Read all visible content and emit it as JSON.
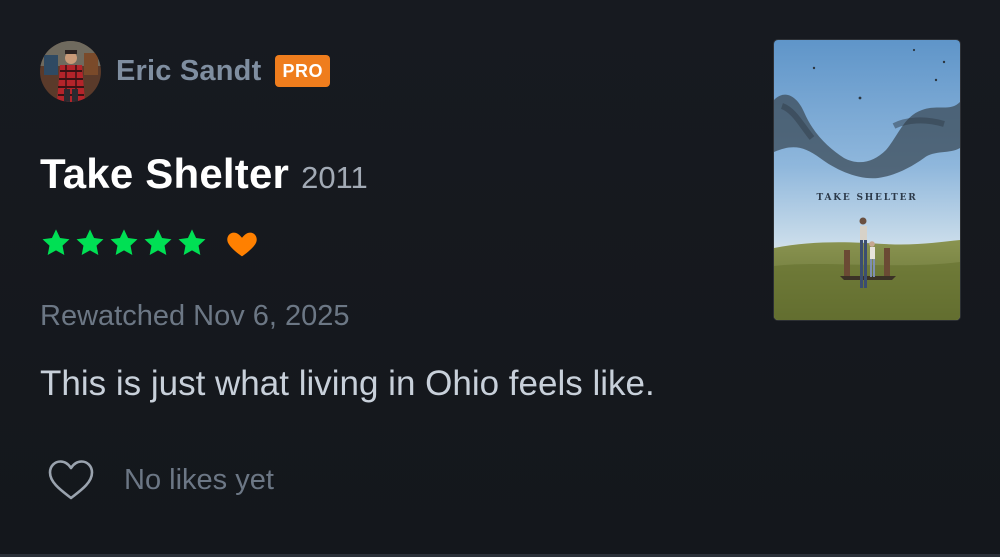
{
  "user": {
    "name": "Eric Sandt",
    "badge": "PRO"
  },
  "film": {
    "title": "Take Shelter",
    "year": "2011",
    "poster_title": "TAKE SHELTER"
  },
  "rating": {
    "stars": 5,
    "max_stars": 5,
    "liked": true,
    "star_color": "#00e054",
    "heart_color": "#ff8000"
  },
  "review": {
    "watch_label": "Rewatched Nov 6, 2025",
    "text": "This is just what living in Ohio feels like."
  },
  "likes": {
    "label": "No likes yet",
    "icon": "heart-outline-icon"
  },
  "colors": {
    "background": "#15181d",
    "pro_badge": "#ef7d1d",
    "username": "#7f8ea0"
  }
}
